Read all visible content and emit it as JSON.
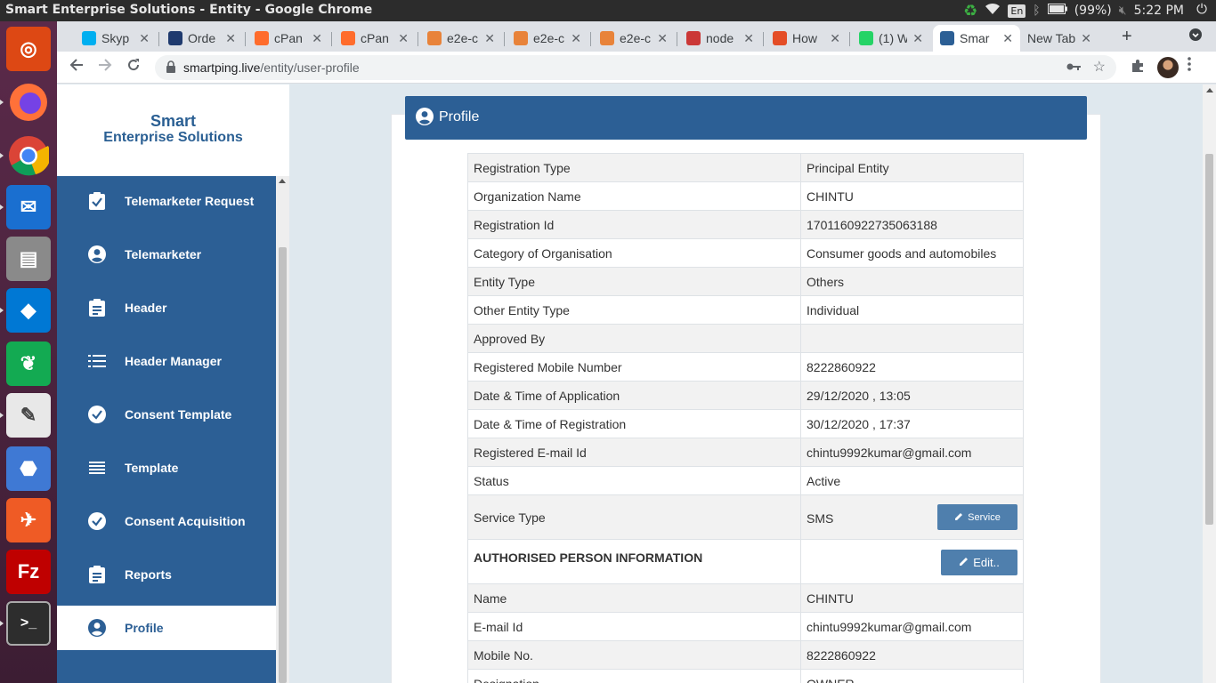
{
  "system": {
    "window_title": "Smart Enterprise Solutions - Entity - Google Chrome",
    "language": "En",
    "battery": "(99%)",
    "clock": "5:22 PM"
  },
  "launcher": [
    {
      "name": "ubuntu-icon",
      "color": "#dd4814"
    },
    {
      "name": "firefox-icon",
      "color": "#ff7139"
    },
    {
      "name": "chrome-icon",
      "color": "#4285f4"
    },
    {
      "name": "thunderbird-icon",
      "color": "#1a6fd0"
    },
    {
      "name": "files-icon",
      "color": "#8a8a8a"
    },
    {
      "name": "vscode-icon",
      "color": "#0078d4"
    },
    {
      "name": "mongodb-compass-icon",
      "color": "#13aa52"
    },
    {
      "name": "text-editor-icon",
      "color": "#e8e8e8"
    },
    {
      "name": "app-icon",
      "color": "#3f79d4"
    },
    {
      "name": "postman-icon",
      "color": "#ef5b25"
    },
    {
      "name": "filezilla-icon",
      "color": "#bf0000"
    },
    {
      "name": "terminal-icon",
      "color": "#2d2d2d"
    }
  ],
  "browser": {
    "tabs": [
      {
        "label": "Skyp",
        "favicon": "#00aff0"
      },
      {
        "label": "Orde",
        "favicon": "#1f3a6e"
      },
      {
        "label": "cPan",
        "favicon": "#ff6c2c"
      },
      {
        "label": "cPan",
        "favicon": "#ff6c2c"
      },
      {
        "label": "e2e-c",
        "favicon": "#e8833a"
      },
      {
        "label": "e2e-c",
        "favicon": "#e8833a"
      },
      {
        "label": "e2e-c",
        "favicon": "#e8833a"
      },
      {
        "label": "node",
        "favicon": "#cb3837"
      },
      {
        "label": "How",
        "favicon": "#e44d26"
      },
      {
        "label": "(1) W",
        "favicon": "#25d366"
      },
      {
        "label": "Smar",
        "favicon": "#2c5f95",
        "active": true
      },
      {
        "label": "New Tab",
        "favicon": ""
      }
    ],
    "url_host": "smartping.live",
    "url_path": "/entity/user-profile"
  },
  "brand": {
    "line1": "Smart",
    "line2": "Enterprise Solutions"
  },
  "sidebar": {
    "items": [
      {
        "label": "Telemarketer Request",
        "icon": "clipboard-check-icon"
      },
      {
        "label": "Telemarketer",
        "icon": "user-circle-icon"
      },
      {
        "label": "Header",
        "icon": "clipboard-icon"
      },
      {
        "label": "Header Manager",
        "icon": "list-icon"
      },
      {
        "label": "Consent Template",
        "icon": "check-circle-icon"
      },
      {
        "label": "Template",
        "icon": "lines-icon"
      },
      {
        "label": "Consent Acquisition",
        "icon": "check-circle-icon"
      },
      {
        "label": "Reports",
        "icon": "clipboard-icon"
      },
      {
        "label": "Profile",
        "icon": "user-circle-icon",
        "active": true
      }
    ]
  },
  "profile": {
    "title": "Profile",
    "rows": [
      {
        "label": "Registration Type",
        "value": "Principal Entity"
      },
      {
        "label": "Organization Name",
        "value": "CHINTU"
      },
      {
        "label": "Registration Id",
        "value": "1701160922735063188"
      },
      {
        "label": "Category of Organisation",
        "value": "Consumer goods and automobiles"
      },
      {
        "label": "Entity Type",
        "value": "Others"
      },
      {
        "label": "Other Entity Type",
        "value": "Individual"
      },
      {
        "label": "Approved By",
        "value": ""
      },
      {
        "label": "Registered Mobile Number",
        "value": "8222860922"
      },
      {
        "label": "Date & Time of Application",
        "value": "29/12/2020 , 13:05"
      },
      {
        "label": "Date & Time of Registration",
        "value": "30/12/2020 , 17:37"
      },
      {
        "label": "Registered E-mail Id",
        "value": "chintu9992kumar@gmail.com"
      },
      {
        "label": "Status",
        "value": "Active"
      }
    ],
    "service_row": {
      "label": "Service Type",
      "value": "SMS",
      "button": "Service"
    },
    "section_heading": "AUTHORISED PERSON INFORMATION",
    "edit_button": "Edit..",
    "person_rows": [
      {
        "label": "Name",
        "value": "CHINTU"
      },
      {
        "label": "E-mail Id",
        "value": "chintu9992kumar@gmail.com"
      },
      {
        "label": "Mobile No.",
        "value": "8222860922"
      },
      {
        "label": "Designation",
        "value": "OWNER"
      }
    ]
  }
}
